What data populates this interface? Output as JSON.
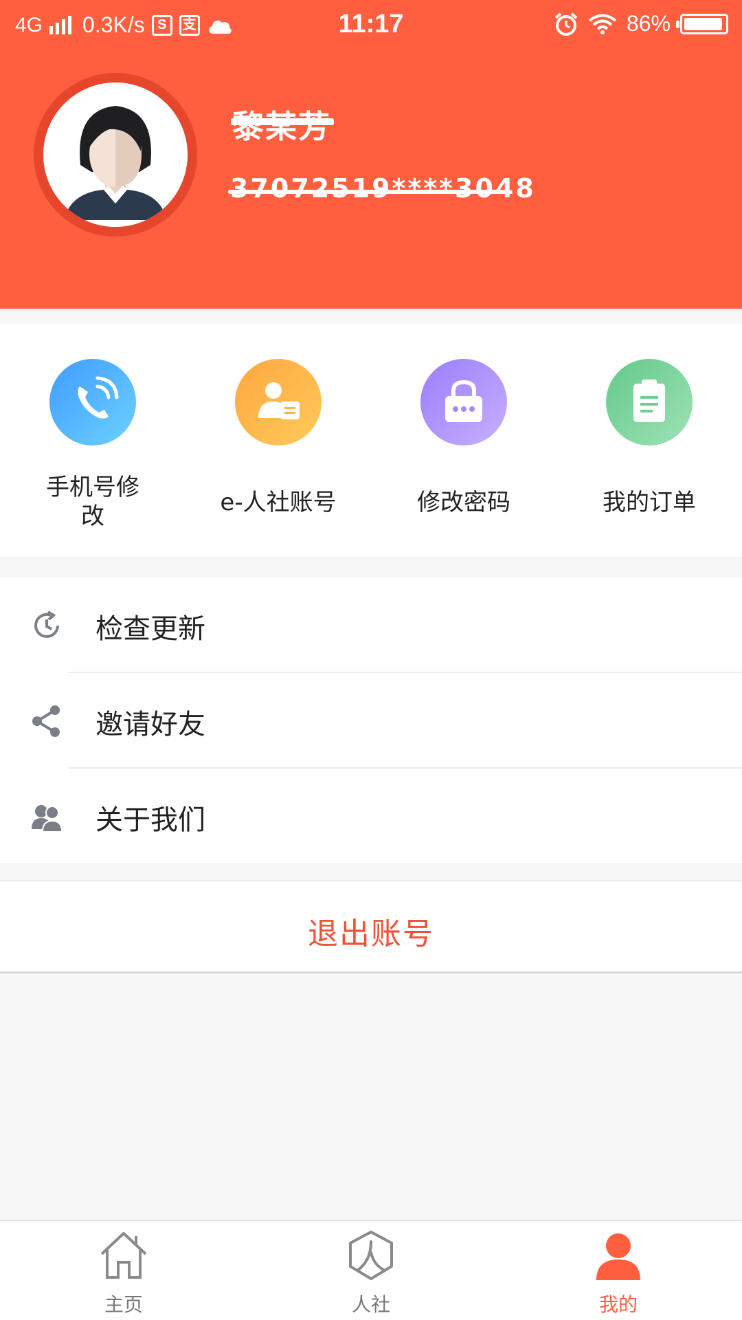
{
  "status_bar": {
    "network": "4G",
    "speed": "0.3K/s",
    "time": "11:17",
    "battery": "86%"
  },
  "profile": {
    "name": "黎某芳",
    "id_number": "37072519****3048"
  },
  "quick_actions": [
    {
      "label": "手机号修改",
      "icon": "phone-icon",
      "color_from": "#3f9cff",
      "color_to": "#6dd1ff"
    },
    {
      "label": "e-人社账号",
      "icon": "account-card-icon",
      "color_from": "#ffa83f",
      "color_to": "#ffc95b"
    },
    {
      "label": "修改密码",
      "icon": "lock-icon",
      "color_from": "#9a7dfb",
      "color_to": "#c9b0ff"
    },
    {
      "label": "我的订单",
      "icon": "clipboard-icon",
      "color_from": "#63c98a",
      "color_to": "#9fe2b6"
    }
  ],
  "menu": [
    {
      "label": "检查更新",
      "icon": "refresh-icon"
    },
    {
      "label": "邀请好友",
      "icon": "share-icon"
    },
    {
      "label": "关于我们",
      "icon": "users-icon"
    }
  ],
  "logout_label": "退出账号",
  "bottom_nav": [
    {
      "label": "主页",
      "icon": "home-icon",
      "active": false
    },
    {
      "label": "人社",
      "icon": "renshe-icon",
      "active": false
    },
    {
      "label": "我的",
      "icon": "profile-icon",
      "active": true
    }
  ],
  "colors": {
    "primary": "#ff5e3f",
    "logout": "#ee5238",
    "inactive_nav": "#777777"
  }
}
